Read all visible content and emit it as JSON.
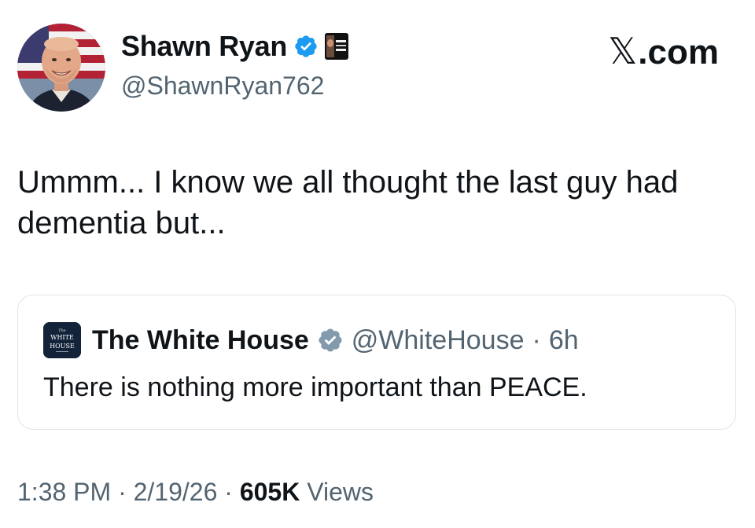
{
  "author": {
    "display_name": "Shawn Ryan",
    "handle": "@ShawnRyan762",
    "verified_color": "#1d9bf0"
  },
  "brand": {
    "label": ".com"
  },
  "tweet": {
    "text": "Ummm... I know we all thought the last guy had dementia but..."
  },
  "quoted_tweet": {
    "display_name": "The White House",
    "handle": "@WhiteHouse",
    "separator": "·",
    "age": "6h",
    "text": "There is nothing more important than PEACE.",
    "verified_color": "#829aab"
  },
  "footer": {
    "time": "1:38 PM",
    "date": "2/19/26",
    "views_count": "605K",
    "views_label": "Views",
    "separator": "·"
  }
}
